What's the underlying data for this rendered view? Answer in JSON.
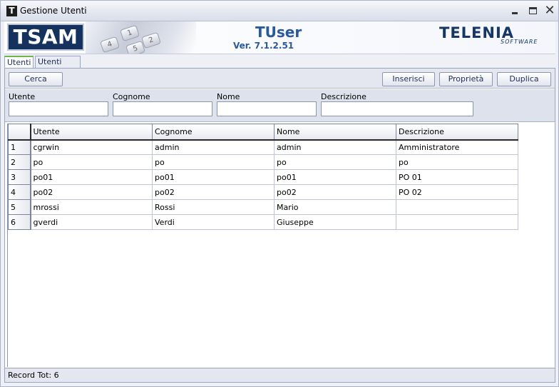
{
  "window": {
    "title": "Gestione Utenti",
    "icon_letter": "T"
  },
  "banner": {
    "left_logo": "TSAM",
    "app_name": "TUser",
    "version": "Ver. 7.1.2.51",
    "brand": "TELENIA",
    "brand_sub": "SOFTWARE",
    "keys": [
      "5",
      "2",
      "4",
      "1"
    ]
  },
  "tabs": [
    {
      "label": "Utenti",
      "active": true
    },
    {
      "label": "Utenti CDC",
      "active": false
    }
  ],
  "toolbar": {
    "search_label": "Cerca",
    "insert_label": "Inserisci",
    "properties_label": "Proprietà",
    "duplicate_label": "Duplica"
  },
  "filters": {
    "user_label": "Utente",
    "surname_label": "Cognome",
    "name_label": "Nome",
    "description_label": "Descrizione",
    "user_value": "",
    "surname_value": "",
    "name_value": "",
    "description_value": ""
  },
  "grid": {
    "columns": [
      "Utente",
      "Cognome",
      "Nome",
      "Descrizione"
    ],
    "rows": [
      {
        "num": "1",
        "utente": "cgrwin",
        "cognome": "admin",
        "nome": "admin",
        "descrizione": "Amministratore"
      },
      {
        "num": "2",
        "utente": "po",
        "cognome": "po",
        "nome": "po",
        "descrizione": "po"
      },
      {
        "num": "3",
        "utente": "po01",
        "cognome": "po01",
        "nome": "po01",
        "descrizione": "PO 01"
      },
      {
        "num": "4",
        "utente": "po02",
        "cognome": "po02",
        "nome": "po02",
        "descrizione": "PO 02"
      },
      {
        "num": "5",
        "utente": "mrossi",
        "cognome": "Rossi",
        "nome": "Mario",
        "descrizione": ""
      },
      {
        "num": "6",
        "utente": "gverdi",
        "cognome": "Verdi",
        "nome": "Giuseppe",
        "descrizione": ""
      }
    ]
  },
  "status": {
    "record_text": "Record Tot: 6"
  }
}
